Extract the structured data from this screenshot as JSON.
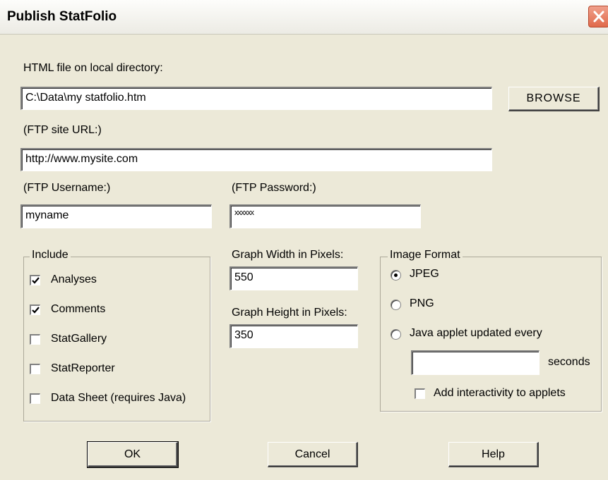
{
  "window": {
    "title": "Publish StatFolio"
  },
  "html_file": {
    "label": "HTML file on local directory:",
    "value": "C:\\Data\\my statfolio.htm",
    "browse_label": "BROWSE"
  },
  "ftp_url": {
    "label": "(FTP site URL:)",
    "value": "http://www.mysite.com"
  },
  "ftp_username": {
    "label": "(FTP Username:)",
    "value": "myname"
  },
  "ftp_password": {
    "label": "(FTP Password:)",
    "value": "xxxxxx"
  },
  "include": {
    "title": "Include",
    "items": [
      {
        "label": "Analyses",
        "checked": true
      },
      {
        "label": "Comments",
        "checked": true
      },
      {
        "label": "StatGallery",
        "checked": false
      },
      {
        "label": "StatReporter",
        "checked": false
      },
      {
        "label": "Data Sheet (requires Java)",
        "checked": false
      }
    ]
  },
  "graph": {
    "width_label": "Graph Width in Pixels:",
    "width_value": "550",
    "height_label": "Graph Height in Pixels:",
    "height_value": "350"
  },
  "image_format": {
    "title": "Image Format",
    "options": [
      {
        "label": "JPEG",
        "selected": true
      },
      {
        "label": "PNG",
        "selected": false
      },
      {
        "label": "Java applet updated every",
        "selected": false
      }
    ],
    "seconds_value": "",
    "seconds_label": "seconds",
    "interactivity_label": "Add interactivity to applets",
    "interactivity_checked": false
  },
  "buttons": {
    "ok": "OK",
    "cancel": "Cancel",
    "help": "Help"
  }
}
